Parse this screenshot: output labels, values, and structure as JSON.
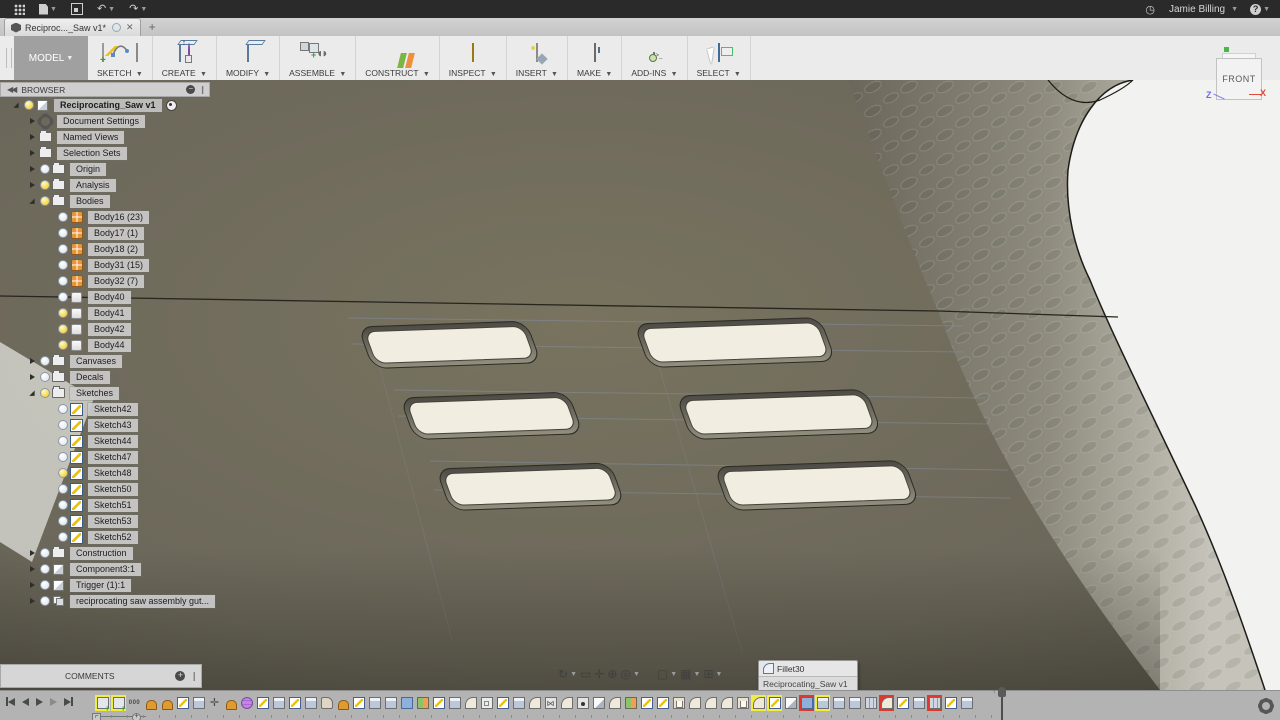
{
  "titlebar": {
    "user_name": "Jamie Billing",
    "icons": [
      "apps-grid",
      "file",
      "save",
      "undo",
      "redo"
    ],
    "right_icons": [
      "clock",
      "help"
    ]
  },
  "tabbar": {
    "active_tab_title": "Reciproc..._Saw v1*",
    "new_tab_label": "+"
  },
  "toolbar": {
    "workspace_label": "MODEL",
    "groups": [
      {
        "label": "SKETCH",
        "icons": [
          "sketch-create-icon",
          "spline-icon",
          "rectangle-icon"
        ]
      },
      {
        "label": "CREATE",
        "icons": [
          "extrude-icon",
          "form-icon"
        ]
      },
      {
        "label": "MODIFY",
        "icons": [
          "press-pull-icon"
        ]
      },
      {
        "label": "ASSEMBLE",
        "icons": [
          "new-component-icon",
          "joint-icon"
        ]
      },
      {
        "label": "CONSTRUCT",
        "icons": [
          "plane-icon"
        ]
      },
      {
        "label": "INSPECT",
        "icons": [
          "measure-icon"
        ]
      },
      {
        "label": "INSERT",
        "icons": [
          "insert-image-icon"
        ]
      },
      {
        "label": "MAKE",
        "icons": [
          "print-icon"
        ]
      },
      {
        "label": "ADD-INS",
        "icons": [
          "scripts-icon"
        ]
      },
      {
        "label": "SELECT",
        "icons": [
          "select-icon"
        ]
      }
    ]
  },
  "browser": {
    "title": "BROWSER",
    "tree": [
      {
        "label": "Reciprocating_Saw v1",
        "lvl": 0,
        "exp": "e",
        "bulb": "y",
        "icon": "comp",
        "root": true
      },
      {
        "label": "Document Settings",
        "lvl": 1,
        "exp": "c",
        "bulb": null,
        "icon": "gear"
      },
      {
        "label": "Named Views",
        "lvl": 1,
        "exp": "c",
        "bulb": null,
        "icon": "folder"
      },
      {
        "label": "Selection Sets",
        "lvl": 1,
        "exp": "c",
        "bulb": null,
        "icon": "folder"
      },
      {
        "label": "Origin",
        "lvl": 1,
        "exp": "c",
        "bulb": "w",
        "icon": "folder"
      },
      {
        "label": "Analysis",
        "lvl": 1,
        "exp": "c",
        "bulb": "y",
        "icon": "folder"
      },
      {
        "label": "Bodies",
        "lvl": 1,
        "exp": "e",
        "bulb": "y",
        "icon": "folder"
      },
      {
        "label": "Body16 (23)",
        "lvl": 2,
        "bulb": "w",
        "icon": "body-o"
      },
      {
        "label": "Body17 (1)",
        "lvl": 2,
        "bulb": "w",
        "icon": "body-o"
      },
      {
        "label": "Body18 (2)",
        "lvl": 2,
        "bulb": "w",
        "icon": "body-o"
      },
      {
        "label": "Body31 (15)",
        "lvl": 2,
        "bulb": "w",
        "icon": "body-o"
      },
      {
        "label": "Body32 (7)",
        "lvl": 2,
        "bulb": "w",
        "icon": "body-o"
      },
      {
        "label": "Body40",
        "lvl": 2,
        "bulb": "w",
        "icon": "body-w"
      },
      {
        "label": "Body41",
        "lvl": 2,
        "bulb": "y",
        "icon": "body-w"
      },
      {
        "label": "Body42",
        "lvl": 2,
        "bulb": "y",
        "icon": "body-w"
      },
      {
        "label": "Body44",
        "lvl": 2,
        "bulb": "y",
        "icon": "body-w"
      },
      {
        "label": "Canvases",
        "lvl": 1,
        "exp": "c",
        "bulb": "w",
        "icon": "folder"
      },
      {
        "label": "Decals",
        "lvl": 1,
        "exp": "c",
        "bulb": "w",
        "icon": "folder"
      },
      {
        "label": "Sketches",
        "lvl": 1,
        "exp": "e",
        "bulb": "y",
        "icon": "folder"
      },
      {
        "label": "Sketch42",
        "lvl": 2,
        "bulb": "w",
        "icon": "sketch"
      },
      {
        "label": "Sketch43",
        "lvl": 2,
        "bulb": "w",
        "icon": "sketch"
      },
      {
        "label": "Sketch44",
        "lvl": 2,
        "bulb": "w",
        "icon": "sketch"
      },
      {
        "label": "Sketch47",
        "lvl": 2,
        "bulb": "w",
        "icon": "sketch"
      },
      {
        "label": "Sketch48",
        "lvl": 2,
        "bulb": "y",
        "icon": "sketch"
      },
      {
        "label": "Sketch50",
        "lvl": 2,
        "bulb": "w",
        "icon": "sketch"
      },
      {
        "label": "Sketch51",
        "lvl": 2,
        "bulb": "w",
        "icon": "sketch"
      },
      {
        "label": "Sketch53",
        "lvl": 2,
        "bulb": "w",
        "icon": "sketch"
      },
      {
        "label": "Sketch52",
        "lvl": 2,
        "bulb": "w",
        "icon": "sketch"
      },
      {
        "label": "Construction",
        "lvl": 1,
        "exp": "c",
        "bulb": "w",
        "icon": "folder"
      },
      {
        "label": "Component3:1",
        "lvl": 1,
        "exp": "c",
        "bulb": "w",
        "icon": "component"
      },
      {
        "label": "Trigger (1):1",
        "lvl": 1,
        "exp": "c",
        "bulb": "w",
        "icon": "component"
      },
      {
        "label": "reciprocating saw assembly gut...",
        "lvl": 1,
        "exp": "c",
        "bulb": "w",
        "icon": "component-multi"
      }
    ]
  },
  "viewport": {
    "viewcube_front_label": "FRONT",
    "axis_x_label": "X",
    "axis_z_label": "Z",
    "surface_color": "#6e6a5d",
    "hole_color": "#f2ede1",
    "background_color": "#f2f2f0"
  },
  "comments": {
    "label": "COMMENTS"
  },
  "navbar": {
    "icons": [
      "orbit",
      "look-at",
      "pan",
      "zoom",
      "fit",
      "display-settings",
      "grid-display",
      "viewports"
    ]
  },
  "tooltip": {
    "feature_name": "Fillet30",
    "document_name": "Reciprocating_Saw v1"
  },
  "timeline": {
    "playback": [
      "go-to-start",
      "step-back",
      "play",
      "step-forward",
      "go-to-end"
    ],
    "highlight_yellow": "#f3ee3b",
    "highlight_red": "#e0382c",
    "features": [
      {
        "t": "comp",
        "h": "y"
      },
      {
        "t": "comp",
        "h": "y"
      },
      {
        "t": "group"
      },
      {
        "t": "joint"
      },
      {
        "t": "joint"
      },
      {
        "t": "sketch"
      },
      {
        "t": "extrude"
      },
      {
        "t": "move"
      },
      {
        "t": "joint"
      },
      {
        "t": "form"
      },
      {
        "t": "sketch"
      },
      {
        "t": "extrude"
      },
      {
        "t": "sketch"
      },
      {
        "t": "extrude"
      },
      {
        "t": "revolve"
      },
      {
        "t": "joint"
      },
      {
        "t": "sketch"
      },
      {
        "t": "extrude"
      },
      {
        "t": "extrude"
      },
      {
        "t": "combine"
      },
      {
        "t": "split"
      },
      {
        "t": "sketch"
      },
      {
        "t": "extrude"
      },
      {
        "t": "fillet"
      },
      {
        "t": "box"
      },
      {
        "t": "sketch"
      },
      {
        "t": "extrude"
      },
      {
        "t": "fillet"
      },
      {
        "t": "mirror"
      },
      {
        "t": "fillet"
      },
      {
        "t": "hole"
      },
      {
        "t": "chamfer"
      },
      {
        "t": "fillet"
      },
      {
        "t": "split"
      },
      {
        "t": "sketch"
      },
      {
        "t": "sketch"
      },
      {
        "t": "shell"
      },
      {
        "t": "fillet"
      },
      {
        "t": "fillet"
      },
      {
        "t": "fillet"
      },
      {
        "t": "shell"
      },
      {
        "t": "fillet",
        "h": "y"
      },
      {
        "t": "sketch",
        "h": "y"
      },
      {
        "t": "chamfer"
      },
      {
        "t": "combine",
        "h": "r"
      },
      {
        "t": "extrude",
        "h": "y"
      },
      {
        "t": "extrude"
      },
      {
        "t": "extrude"
      },
      {
        "t": "pattern"
      },
      {
        "t": "fillet",
        "h": "r"
      },
      {
        "t": "sketch"
      },
      {
        "t": "extrude"
      },
      {
        "t": "pattern",
        "h": "r"
      },
      {
        "t": "sketch"
      },
      {
        "t": "extrude"
      }
    ]
  }
}
